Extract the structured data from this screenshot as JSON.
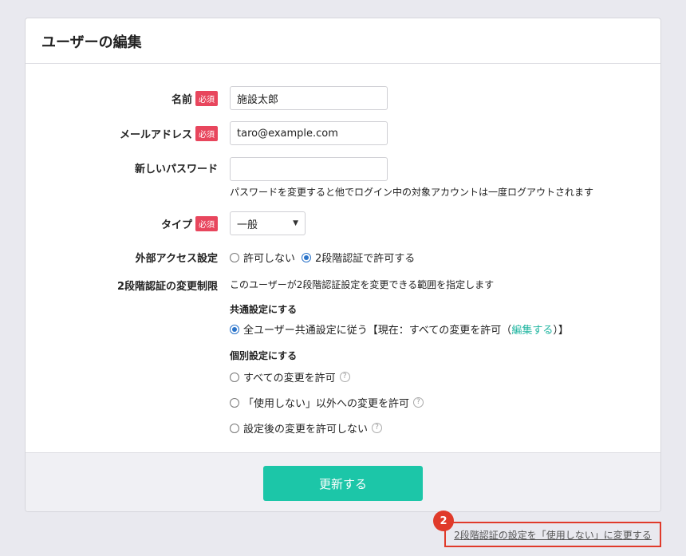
{
  "page_title": "ユーザーの編集",
  "required_label": "必須",
  "form": {
    "name": {
      "label": "名前",
      "value": "施設太郎"
    },
    "email": {
      "label": "メールアドレス",
      "value": "taro@example.com"
    },
    "password": {
      "label": "新しいパスワード",
      "value": "",
      "help": "パスワードを変更すると他でログイン中の対象アカウントは一度ログアウトされます"
    },
    "type": {
      "label": "タイプ",
      "value": "一般"
    },
    "external_access": {
      "label": "外部アクセス設定",
      "options": [
        "許可しない",
        "2段階認証で許可する"
      ],
      "selected_index": 1
    },
    "two_factor": {
      "label": "2段階認証の変更制限",
      "description": "このユーザーが2段階認証設定を変更できる範囲を指定します",
      "common_heading": "共通設定にする",
      "common_option_prefix": "全ユーザー共通設定に従う【現在：すべての変更を許可（",
      "common_option_link": "編集する",
      "common_option_suffix": "）】",
      "individual_heading": "個別設定にする",
      "individual_options": [
        "すべての変更を許可",
        "「使用しない」以外への変更を許可",
        "設定後の変更を許可しない"
      ],
      "help_glyph": "?"
    }
  },
  "footer": {
    "submit_label": "更新する"
  },
  "bottom_link": "2段階認証の設定を「使用しない」に変更する",
  "badge": "2",
  "colors": {
    "accent": "#1cc6a8",
    "required": "#e8465d",
    "highlight": "#e03a2a",
    "radio": "#2a73c9"
  }
}
